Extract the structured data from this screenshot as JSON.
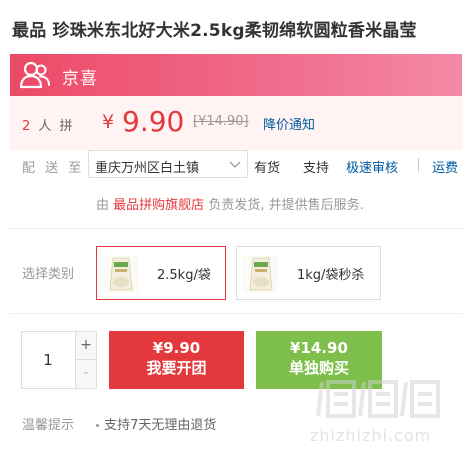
{
  "product": {
    "title": "最品 珍珠米东北好大米2.5kg柔韧绵软圆粒香米晶莹"
  },
  "banner": {
    "brand": "京喜",
    "icon": "users-icon",
    "colors": {
      "start": "#ec4a66",
      "end": "#f48aa6"
    }
  },
  "price": {
    "group_count": "2",
    "group_unit": "人 拼",
    "currency": "¥",
    "current": "9.90",
    "original": "[¥14.90]",
    "notify_label": "降价通知",
    "color": "#e4393c"
  },
  "shipping": {
    "label": "配 送 至",
    "address": "重庆万州区白土镇",
    "stock": "有货",
    "support": "支持",
    "fast_check": "极速审核",
    "fee": "运费"
  },
  "service": {
    "prefix": "由",
    "store": "最品拼购旗舰店",
    "suffix": "负责发货, 并提供售后服务."
  },
  "specs": {
    "label": "选择类别",
    "options": [
      {
        "label": "2.5kg/袋",
        "selected": true
      },
      {
        "label": "1kg/袋秒杀",
        "selected": false
      }
    ]
  },
  "purchase": {
    "quantity": "1",
    "plus": "+",
    "minus": "-",
    "group_btn": {
      "price": "¥9.90",
      "label": "我要开团",
      "color": "#e4393c"
    },
    "single_btn": {
      "price": "¥14.90",
      "label": "单独购买",
      "color": "#7dbf4a"
    }
  },
  "tips": {
    "label": "温馨提示",
    "items": [
      "支持7天无理由退货"
    ]
  },
  "watermark": {
    "url": "zhizhizhi.com"
  }
}
